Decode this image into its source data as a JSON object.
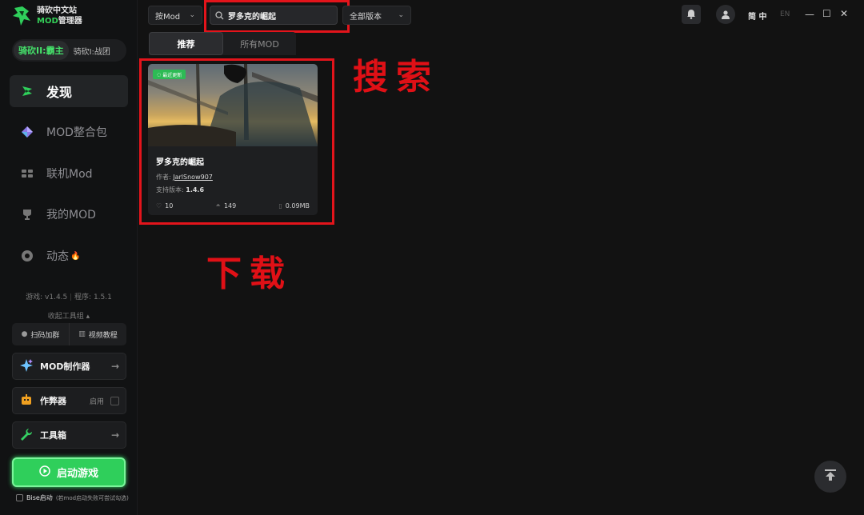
{
  "app": {
    "title_line1": "骑砍中文站",
    "title_line2_accent": "MOD",
    "title_line2": "管理器"
  },
  "game_switch": {
    "active": "骑砍II:霸主",
    "other": "骑砍I:战团"
  },
  "nav": [
    {
      "label": "发现",
      "icon": "discover-icon"
    },
    {
      "label": "MOD整合包",
      "icon": "diamond-icon"
    },
    {
      "label": "联机Mod",
      "icon": "multiplayer-icon"
    },
    {
      "label": "我的MOD",
      "icon": "trophy-icon"
    },
    {
      "label": "动态",
      "icon": "chat-icon"
    }
  ],
  "version": {
    "game": "游戏: v1.4.5",
    "program": "程序: 1.5.1"
  },
  "collapse_tools": "收起工具组 ▴",
  "tool_row": {
    "scan": "扫码加群",
    "video": "视频教程"
  },
  "tools": {
    "mod_maker": "MOD制作器",
    "cheat": "作弊器",
    "cheat_toggle": "启用",
    "toolbox": "工具箱"
  },
  "start_button": "启动游戏",
  "bise": "Bise启动",
  "bise_hint": "(若mod启动失败可尝试勾选)",
  "topbar": {
    "sort_select": "按Mod",
    "search_value": "罗多克的崛起",
    "version_select": "全部版本",
    "lang_active": "简 中",
    "lang_other": "EN"
  },
  "tabs": [
    {
      "label": "推荐"
    },
    {
      "label": "所有MOD"
    }
  ],
  "card": {
    "badge": "最近更新",
    "title": "罗多克的崛起",
    "author_label": "作者:",
    "author": "JarlSnow907",
    "version_label": "支持版本:",
    "version": "1.4.6",
    "likes": "10",
    "downloads": "149",
    "size": "0.09MB"
  },
  "annotations": {
    "search": "搜索",
    "download": "下载"
  },
  "colors": {
    "accent": "#2fcf5b",
    "annotation": "#e3141b",
    "background": "#121212"
  }
}
